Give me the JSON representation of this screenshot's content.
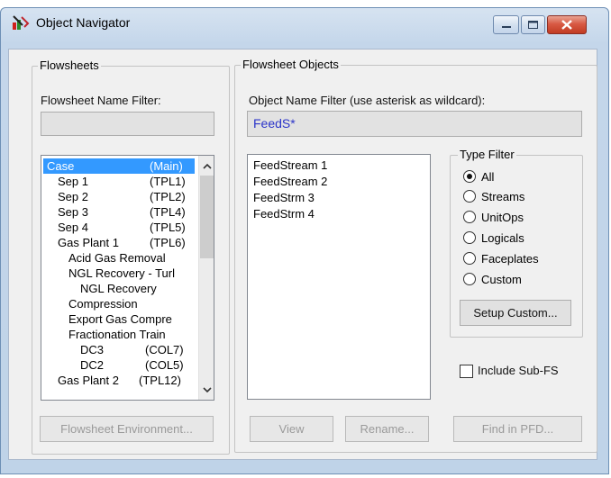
{
  "window": {
    "title": "Object Navigator"
  },
  "flowsheets": {
    "group_label": "Flowsheets",
    "name_filter_label": "Flowsheet Name Filter:",
    "name_filter_value": "",
    "tree": [
      {
        "label": "Case",
        "tag": "(Main)",
        "selected": true
      },
      {
        "label": "Sep 1",
        "tag": "(TPL1)"
      },
      {
        "label": "Sep 2",
        "tag": "(TPL2)"
      },
      {
        "label": "Sep 3",
        "tag": "(TPL4)"
      },
      {
        "label": "Sep 4",
        "tag": "(TPL5)"
      },
      {
        "label": "Gas Plant 1",
        "tag": "(TPL6)"
      },
      {
        "label": "Acid Gas Removal",
        "tag": ""
      },
      {
        "label": "NGL Recovery - Turl",
        "tag": ""
      },
      {
        "label": "NGL Recovery",
        "tag": ""
      },
      {
        "label": "Compression",
        "tag": ""
      },
      {
        "label": "Export Gas Compre",
        "tag": ""
      },
      {
        "label": "Fractionation Train",
        "tag": ""
      },
      {
        "label": "DC3",
        "tag": "(COL7)"
      },
      {
        "label": "DC2",
        "tag": "(COL5)"
      },
      {
        "label": "Gas Plant 2",
        "tag": "(TPL12)"
      }
    ],
    "environment_button": "Flowsheet Environment..."
  },
  "objects": {
    "group_label": "Flowsheet Objects",
    "name_filter_label": "Object Name Filter (use asterisk as wildcard):",
    "name_filter_value": "FeedS*",
    "items": [
      "FeedStream 1",
      "FeedStream 2",
      "FeedStrm 3",
      "FeedStrm 4"
    ],
    "type_filter": {
      "label": "Type Filter",
      "options": [
        "All",
        "Streams",
        "UnitOps",
        "Logicals",
        "Faceplates",
        "Custom"
      ],
      "selected": "All",
      "setup_button": "Setup Custom..."
    },
    "include_sub_fs": {
      "label": "Include Sub-FS",
      "checked": false
    },
    "buttons": {
      "view": "View",
      "rename": "Rename...",
      "find": "Find in PFD..."
    }
  }
}
